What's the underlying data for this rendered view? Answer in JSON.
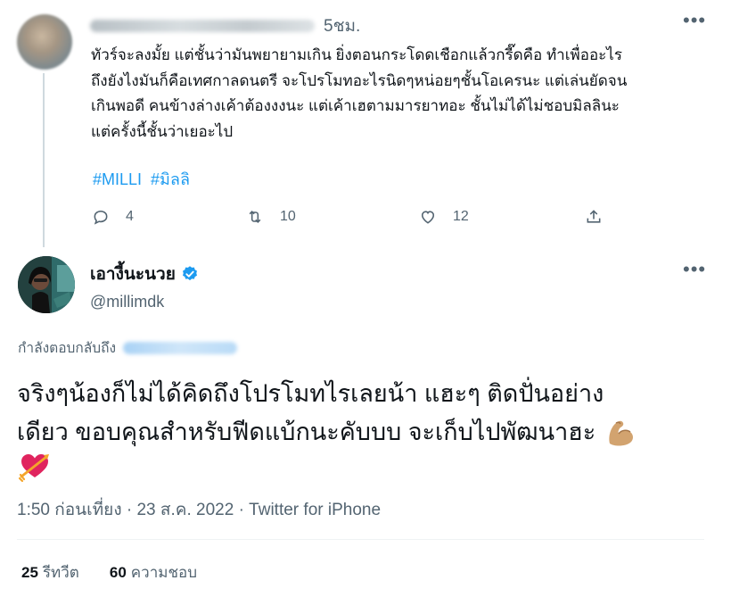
{
  "parent_tweet": {
    "time": "5ชม.",
    "text_lines": [
      "ทัวร์จะลงมั้ย แต่ชั้นว่ามันพยายามเกิน ยิ่งตอนกระโดดเชือกแล้วกรี๊ดคือ ทำเพื่ออะไร",
      "ถึงยังไงมันก็คือเทศกาลดนตรี จะโปรโมทอะไรนิดๆหน่อยๆชั้นโอเครนะ แต่เล่นยัดจน",
      "เกินพอดี คนข้างล่างเค้าต้องงงนะ แต่เค้าเฮตามมารยาทอะ ชั้นไม่ได้ไม่ชอบมิลลินะ",
      "แต่ครั้งนี้ชั้นว่าเยอะไป"
    ],
    "hashtags": [
      "#MILLI",
      "#มิลลิ"
    ],
    "actions": {
      "reply_count": "4",
      "retweet_count": "10",
      "like_count": "12"
    }
  },
  "reply_tweet": {
    "display_name": "เอางี้นะนวย",
    "handle": "@millimdk",
    "replying_to_label": "กำลังตอบกลับถึง",
    "text_lines": [
      "จริงๆน้องก็ไม่ได้คิดถึงโปรโมทไรเลยน้า แฮะๆ ติดปั่นอย่าง",
      "เดียว ขอบคุณสำหรับฟีดแบ้กนะคับบบ จะเก็บไปพัฒนาฮะ"
    ],
    "emojis": [
      "flexed-biceps",
      "heart-with-arrow"
    ],
    "meta": "1:50 ก่อนเที่ยง · 23 ส.ค. 2022 · Twitter for iPhone",
    "stats": {
      "retweets_value": "25",
      "retweets_label": "รีทวีต",
      "likes_value": "60",
      "likes_label": "ความชอบ"
    }
  },
  "colors": {
    "text": "#0f1419",
    "secondary": "#536471",
    "accent": "#1d9bf0",
    "divider": "#eff3f4"
  },
  "icons": [
    "reply-icon",
    "retweet-icon",
    "like-icon",
    "share-icon",
    "verified-badge-icon",
    "more-icon"
  ]
}
